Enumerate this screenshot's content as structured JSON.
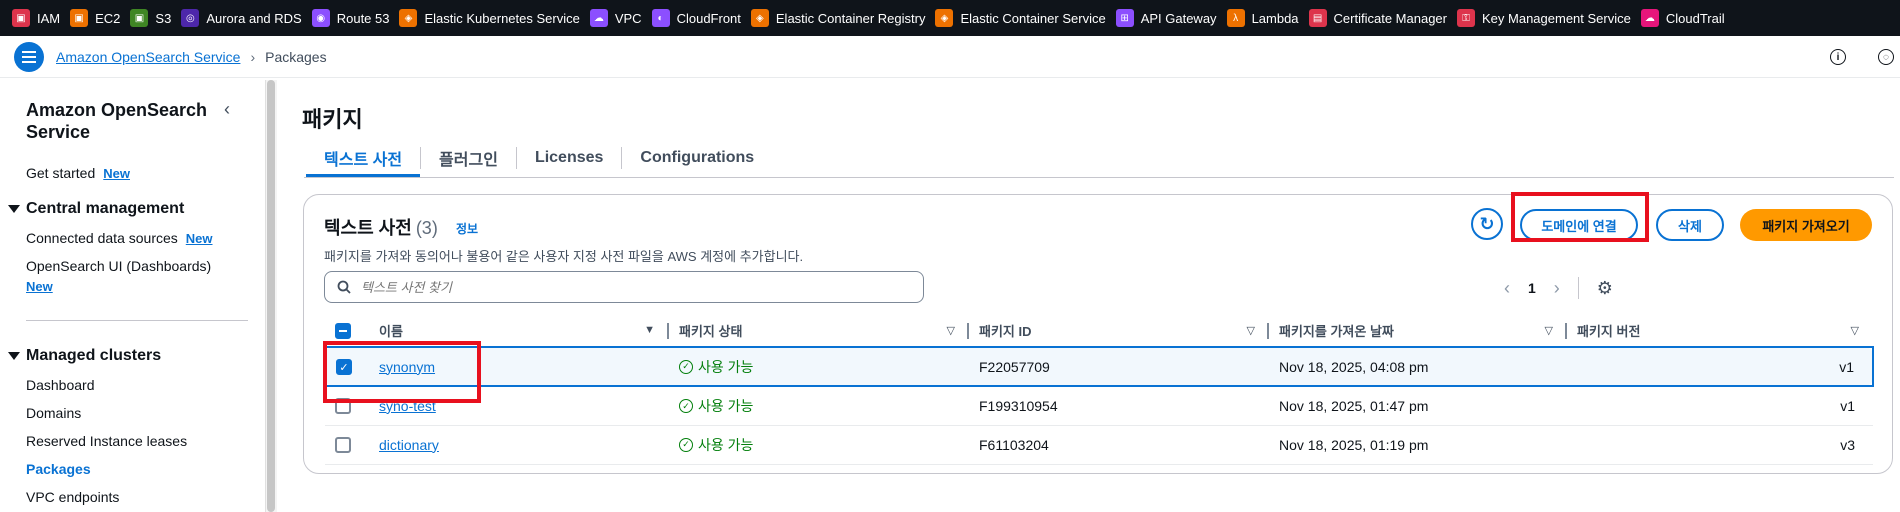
{
  "favorites": [
    {
      "label": "IAM",
      "color": "#dd344c",
      "icon": "iam-icon"
    },
    {
      "label": "EC2",
      "color": "#ed7100",
      "icon": "ec2-icon"
    },
    {
      "label": "S3",
      "color": "#3f8624",
      "icon": "s3-icon"
    },
    {
      "label": "Aurora and RDS",
      "color": "#4d27aa",
      "icon": "rds-icon"
    },
    {
      "label": "Route 53",
      "color": "#8c4fff",
      "icon": "route53-icon"
    },
    {
      "label": "Elastic Kubernetes Service",
      "color": "#ed7100",
      "icon": "eks-icon"
    },
    {
      "label": "VPC",
      "color": "#8c4fff",
      "icon": "vpc-icon"
    },
    {
      "label": "CloudFront",
      "color": "#8c4fff",
      "icon": "cloudfront-icon"
    },
    {
      "label": "Elastic Container Registry",
      "color": "#ed7100",
      "icon": "ecr-icon"
    },
    {
      "label": "Elastic Container Service",
      "color": "#ed7100",
      "icon": "ecs-icon"
    },
    {
      "label": "API Gateway",
      "color": "#8c4fff",
      "icon": "api-gateway-icon"
    },
    {
      "label": "Lambda",
      "color": "#ed7100",
      "icon": "lambda-icon"
    },
    {
      "label": "Certificate Manager",
      "color": "#dd344c",
      "icon": "acm-icon"
    },
    {
      "label": "Key Management Service",
      "color": "#dd344c",
      "icon": "kms-icon"
    },
    {
      "label": "CloudTrail",
      "color": "#e7157b",
      "icon": "cloudtrail-icon"
    }
  ],
  "breadcrumb": {
    "service": "Amazon OpenSearch Service",
    "current": "Packages"
  },
  "sidebar": {
    "title": "Amazon OpenSearch Service",
    "get_started": "Get started",
    "new_badge": "New",
    "central_section": "Central management",
    "connected_sources": "Connected data sources",
    "opensearch_ui": "OpenSearch UI (Dashboards)",
    "managed_section": "Managed clusters",
    "managed_items": [
      "Dashboard",
      "Domains",
      "Reserved Instance leases",
      "Packages",
      "VPC endpoints"
    ],
    "active_item": "Packages"
  },
  "page": {
    "title": "패키지",
    "tabs": [
      "텍스트 사전",
      "플러그인",
      "Licenses",
      "Configurations"
    ],
    "active_tab": "텍스트 사전"
  },
  "container": {
    "title": "텍스트 사전",
    "count": "(3)",
    "info": "정보",
    "description": "패키지를 가져와 동의어나 불용어 같은 사용자 지정 사전 파일을 AWS 계정에 추가합니다.",
    "associate_btn": "도메인에 연결",
    "delete_btn": "삭제",
    "import_btn": "패키지 가져오기",
    "search_placeholder": "텍스트 사전 찾기",
    "page_number": "1"
  },
  "table": {
    "columns": [
      "이름",
      "패키지 상태",
      "패키지 ID",
      "패키지를 가져온 날짜",
      "패키지 버전"
    ],
    "rows": [
      {
        "name": "synonym",
        "status": "사용 가능",
        "id": "F22057709",
        "date": "Nov 18, 2025, 04:08 pm",
        "version": "v1",
        "selected": true
      },
      {
        "name": "syno-test",
        "status": "사용 가능",
        "id": "F199310954",
        "date": "Nov 18, 2025, 01:47 pm",
        "version": "v1",
        "selected": false
      },
      {
        "name": "dictionary",
        "status": "사용 가능",
        "id": "F61103204",
        "date": "Nov 18, 2025, 01:19 pm",
        "version": "v3",
        "selected": false
      }
    ]
  },
  "colors": {
    "accent": "#0972d3",
    "primary_button": "#ff9900",
    "success": "#037f0c",
    "highlight": "#e8101e"
  }
}
